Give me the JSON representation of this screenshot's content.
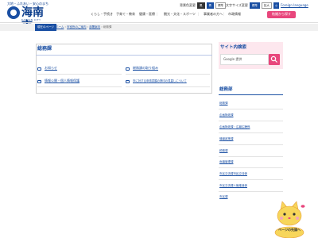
{
  "header": {
    "catch": "大地・ふれあい・安心のまち",
    "logo_text": "海南市",
    "logo_sub": "KAINAN CITY"
  },
  "utility": {
    "bg_label": "背景色変更",
    "bg_black": "黒",
    "bg_blue": "青",
    "bg_std": "標準",
    "font_label": "文字サイズ変更",
    "font_std": "標準",
    "font_large": "拡大",
    "foreign": "Foreign language"
  },
  "gnav": [
    "くらし・手続き",
    "子育て・教育",
    "健康・医療",
    "観光・文化・スポーツ",
    "事業者の方へ",
    "市政情報",
    "結婚から探す"
  ],
  "breadcrumb": {
    "current_label": "現在のページ",
    "items": [
      "ホーム",
      "市役所のご案内",
      "部署案内",
      "総務課"
    ]
  },
  "main": {
    "title": "総務課",
    "links": [
      "お知らせ",
      "総務課の取り組み",
      "情報公開・個人情報保護",
      "市に対する申請書類の押印の見直しについて"
    ]
  },
  "search": {
    "title": "サイト内検索",
    "placeholder": "Google 提供"
  },
  "side": {
    "title": "総務部",
    "items": [
      "総務課",
      "企画財政課",
      "企画財政課・広報広聴係",
      "情報政策課",
      "税務課",
      "危機管理課",
      "市民交流課市民交流係",
      "市民交流課人権推進係",
      "市民課"
    ]
  },
  "mascot": {
    "label": "ページの先頭へ"
  },
  "colors": {
    "accent_blue": "#1a4fa3",
    "accent_pink": "#e8467c"
  }
}
